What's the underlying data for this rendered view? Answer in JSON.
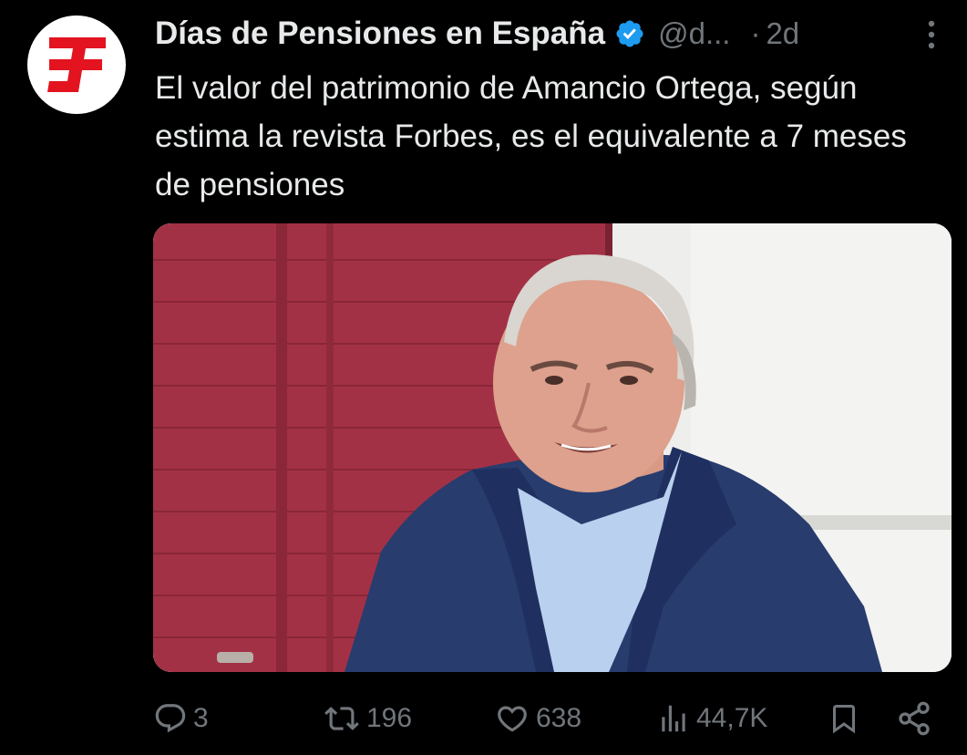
{
  "tweet": {
    "display_name": "Días de Pensiones en España",
    "handle": "@d...",
    "separator": "·",
    "time": "2d",
    "text": "El valor del patrimonio de Amancio Ortega, según estima la revista Forbes, es el equivalente a 7 meses de pensiones",
    "verified": true
  },
  "avatar": {
    "icon": "brand-logo-icon",
    "brand_color": "#e3141f"
  },
  "media": {
    "icon": "photo-older-man-navy-jacket"
  },
  "actions": {
    "reply": {
      "icon": "reply-icon",
      "count": "3"
    },
    "retweet": {
      "icon": "retweet-icon",
      "count": "196"
    },
    "like": {
      "icon": "heart-icon",
      "count": "638"
    },
    "views": {
      "icon": "views-icon",
      "count": "44,7K"
    },
    "bookmark": {
      "icon": "bookmark-icon"
    },
    "share": {
      "icon": "share-icon"
    }
  },
  "colors": {
    "background": "#000000",
    "primary_text": "#e7e9ea",
    "secondary_text": "#71767b",
    "verified_blue": "#1d9bf0"
  }
}
